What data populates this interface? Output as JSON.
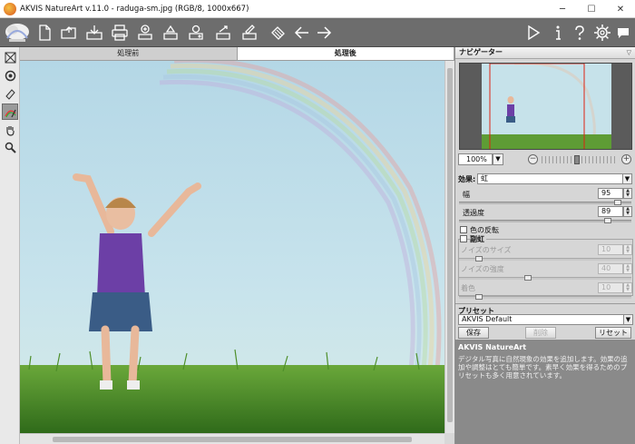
{
  "window": {
    "title": "AKVIS NatureArt v.11.0 - raduga-sm.jpg (RGB/8, 1000x667)",
    "minimize": "─",
    "maximize": "☐",
    "close": "✕"
  },
  "toolbar": {
    "icons": [
      "new-doc-icon",
      "open-file-icon",
      "save-file-icon",
      "print-icon",
      "share-icon",
      "batch-icon",
      "export-icon",
      "import-icon",
      "settings-doc-icon",
      "hand-brush-icon",
      "undo-arrow-icon",
      "redo-arrow-icon"
    ],
    "right_icons": [
      "run-icon",
      "info-icon",
      "help-icon",
      "gear-icon",
      "message-icon"
    ]
  },
  "tabs": {
    "before": "処理前",
    "after": "処理後"
  },
  "navigator": {
    "title": "ナビゲーター",
    "zoom": "100%"
  },
  "effect": {
    "label": "効果:",
    "value": "虹"
  },
  "params": {
    "width_label": "幅",
    "width_value": "95",
    "width_fraction": 0.95,
    "transparency_label": "透過度",
    "transparency_value": "89",
    "transparency_fraction": 0.89,
    "invert_label": "色の反転",
    "double_label": "副虹",
    "noise_size_label": "ノイズのサイズ",
    "noise_size_value": "10",
    "noise_size_fraction": 0.1,
    "noise_strength_label": "ノイズの強度",
    "noise_strength_value": "40",
    "noise_strength_fraction": 0.4,
    "tint_label": "着色",
    "tint_value": "10",
    "tint_fraction": 0.1
  },
  "presets": {
    "title": "プリセット",
    "current": "AKVIS Default",
    "save": "保存",
    "delete": "削除",
    "reset": "リセット"
  },
  "help": {
    "title": "AKVIS NatureArt",
    "text": "デジタル写真に自然現象の効果を追加します。効果の追加や調整はとても簡単です。素早く効果を得るためのプリセットも多く用意されています。"
  },
  "colors": {
    "toolbar_bg": "#6d6d6d",
    "panel_bg": "#d6d6d6",
    "help_bg": "#8a8a8a"
  }
}
